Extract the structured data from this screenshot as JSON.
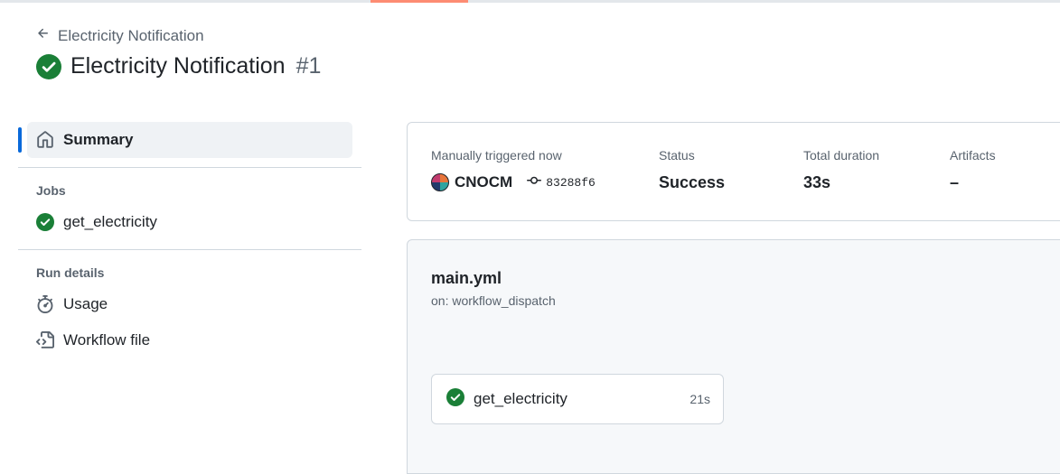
{
  "header": {
    "back_label": "Electricity Notification",
    "title": "Electricity Notification",
    "run_number": "#1"
  },
  "sidebar": {
    "summary_label": "Summary",
    "jobs_heading": "Jobs",
    "jobs": [
      {
        "label": "get_electricity",
        "status": "success"
      }
    ],
    "run_details_heading": "Run details",
    "usage_label": "Usage",
    "workflow_file_label": "Workflow file"
  },
  "summary": {
    "trigger_label": "Manually triggered now",
    "actor": "CNOCM",
    "commit": "83288f6",
    "status_label": "Status",
    "status_value": "Success",
    "duration_label": "Total duration",
    "duration_value": "33s",
    "artifacts_label": "Artifacts",
    "artifacts_value": "–"
  },
  "workflow": {
    "file_name": "main.yml",
    "trigger": "on: workflow_dispatch",
    "job": {
      "name": "get_electricity",
      "duration": "21s"
    }
  },
  "colors": {
    "success": "#1a7f37",
    "accent_bar": "#0969da",
    "tab_underline": "#fd8c73"
  },
  "icons": {
    "back": "arrow-left-icon",
    "status": "check-circle-icon",
    "summary": "home-icon",
    "usage": "stopwatch-icon",
    "workflow_file": "file-code-icon",
    "commit": "git-commit-icon"
  }
}
